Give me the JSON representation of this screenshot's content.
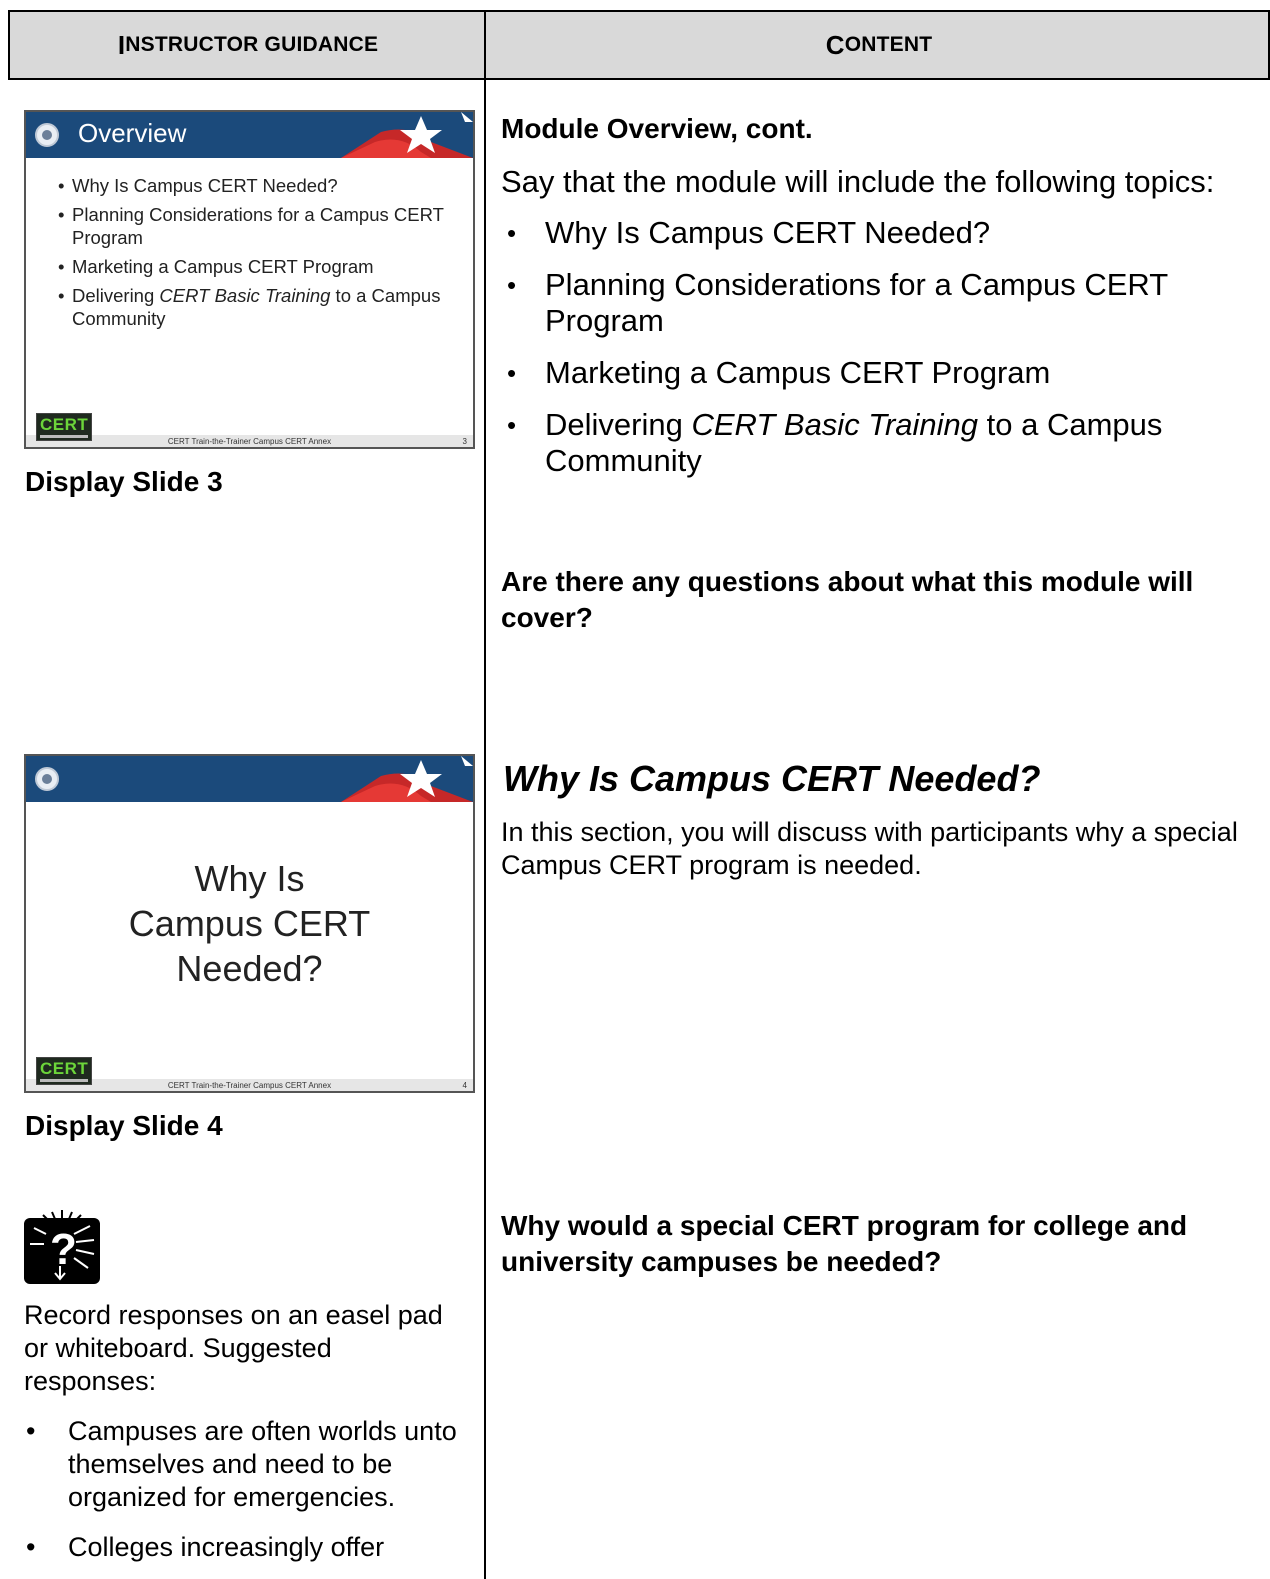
{
  "header": {
    "left_initial": "I",
    "left_rest": "NSTRUCTOR GUIDANCE",
    "right_initial": "C",
    "right_rest": "ONTENT"
  },
  "slide3": {
    "title": "Overview",
    "bullets": [
      "Why Is Campus CERT Needed?",
      "Planning Considerations for a Campus CERT Program",
      "Marketing a Campus CERT Program"
    ],
    "bullet4_pre": "Delivering ",
    "bullet4_em": "CERT Basic Training",
    "bullet4_post": " to a Campus Community",
    "logo_text": "CERT",
    "footer": "CERT Train-the-Trainer Campus CERT Annex",
    "number": "3",
    "label": "Display Slide 3"
  },
  "slide4": {
    "title_line1": "Why Is",
    "title_line2": "Campus CERT",
    "title_line3": "Needed?",
    "logo_text": "CERT",
    "footer": "CERT Train-the-Trainer Campus CERT Annex",
    "number": "4",
    "label": "Display Slide 4"
  },
  "left": {
    "icon": "question-discussion-icon",
    "record_text": "Record responses on an easel pad or whiteboard. Suggested responses:",
    "responses": [
      "Campuses are often worlds unto themselves and need to be organized for emergencies.",
      "Colleges increasingly offer"
    ]
  },
  "right": {
    "overview_heading": "Module Overview, cont.",
    "say_text": "Say that the module will include the following topics:",
    "topics": [
      "Why Is Campus CERT Needed?",
      "Planning Considerations for a Campus CERT Program",
      "Marketing a Campus CERT Program"
    ],
    "topic4_pre": "Delivering ",
    "topic4_em": "CERT Basic Training",
    "topic4_post": " to a Campus Community",
    "questions_prompt": "Are there any questions about what this module will cover?",
    "section_heading": "Why Is Campus CERT Needed?",
    "section_intro": "In this section, you will discuss with participants why a special Campus CERT program is needed.",
    "discussion_question": "Why would a special CERT program for college and university campuses be needed?"
  }
}
